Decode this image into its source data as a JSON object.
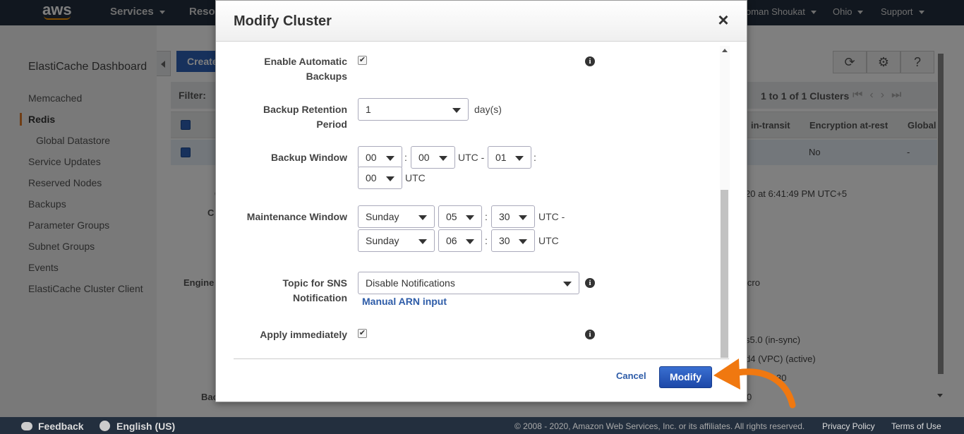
{
  "topnav": {
    "logo": "aws",
    "services": "Services",
    "resource_groups": "Reso",
    "user": "oman Shoukat",
    "region": "Ohio",
    "support": "Support"
  },
  "sidebar": {
    "title": "ElastiCache Dashboard",
    "items": [
      {
        "label": "Memcached"
      },
      {
        "label": "Redis"
      },
      {
        "label": "Global Datastore"
      },
      {
        "label": "Service Updates"
      },
      {
        "label": "Reserved Nodes"
      },
      {
        "label": "Backups"
      },
      {
        "label": "Parameter Groups"
      },
      {
        "label": "Subnet Groups"
      },
      {
        "label": "Events"
      },
      {
        "label": "ElastiCache Cluster Client"
      }
    ]
  },
  "main": {
    "create_label": "Create",
    "filter_label": "Filter:",
    "pager": "1 to 1 of 1 Clusters",
    "columns": [
      "in-transit",
      "Encryption at-rest",
      "Global"
    ],
    "row": {
      "encryption_at_rest": "No",
      "global": "-"
    },
    "bg_texts": {
      "created": "20 at 6:41:49 PM UTC+5",
      "node_type": "icro",
      "param_group": "s5.0 (in-sync)",
      "subnet": "d4 (VPC) (active)",
      "time": "30",
      "misc": "0",
      "engine_label": "Engine",
      "c_label": "C",
      "ca_label": "C",
      "bac_label": "Bac"
    }
  },
  "modal": {
    "title": "Modify Cluster",
    "auto_backups": {
      "label_line1": "Enable Automatic",
      "label_line2": "Backups",
      "checked": true
    },
    "retention": {
      "label_line1": "Backup Retention",
      "label_line2": "Period",
      "value": "1",
      "unit": "day(s)"
    },
    "backup_window": {
      "label": "Backup Window",
      "start_hour": "00",
      "start_min": "00",
      "sep": ":",
      "utc_dash": "UTC -",
      "end_hour": "01",
      "end_min": "00",
      "utc": "UTC"
    },
    "maintenance_window": {
      "label": "Maintenance Window",
      "start_day": "Sunday",
      "start_hour": "05",
      "start_min": "30",
      "utc_dash": "UTC -",
      "end_day": "Sunday",
      "end_hour": "06",
      "end_min": "30",
      "utc": "UTC"
    },
    "sns": {
      "label_line1": "Topic for SNS",
      "label_line2": "Notification",
      "value": "Disable Notifications",
      "manual_arn": "Manual ARN input"
    },
    "apply_immediately": {
      "label": "Apply immediately",
      "checked": true
    },
    "cancel": "Cancel",
    "modify": "Modify"
  },
  "footer": {
    "feedback": "Feedback",
    "language": "English (US)",
    "copyright": "© 2008 - 2020, Amazon Web Services, Inc. or its affiliates. All rights reserved.",
    "privacy": "Privacy Policy",
    "terms": "Terms of Use"
  },
  "colors": {
    "accent": "#2e63b8",
    "annotation": "#f07810",
    "nav_bg": "#232f3e"
  }
}
